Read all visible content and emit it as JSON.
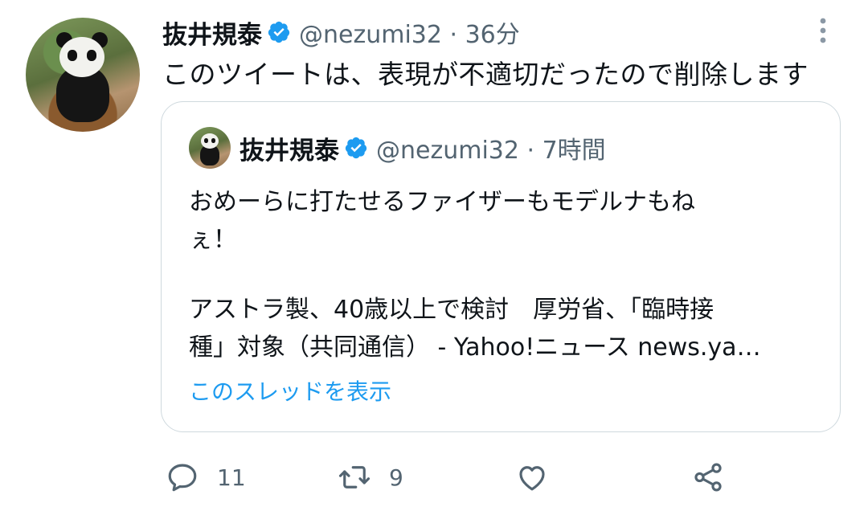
{
  "tweet": {
    "author_name": "抜井規泰",
    "handle_time": "@nezumi32 · 36分",
    "text": "このツイートは、表現が不適切だったので削除します"
  },
  "quoted_tweet": {
    "author_name": "抜井規泰",
    "handle_time": "@nezumi32 · 7時間",
    "lines": [
      "おめーらに打たせるファイザーもモデルナもね",
      "ぇ！",
      "アストラ製、40歳以上で検討　厚労省、「臨時接",
      "種」対象（共同通信） - Yahoo!ニュース news.ya…"
    ],
    "show_thread": "このスレッドを表示"
  },
  "actions": {
    "reply_count": "11",
    "retweet_count": "9"
  },
  "colors": {
    "accent": "#1d9bf0",
    "secondary_text": "#536471",
    "border": "#cfd9de"
  }
}
